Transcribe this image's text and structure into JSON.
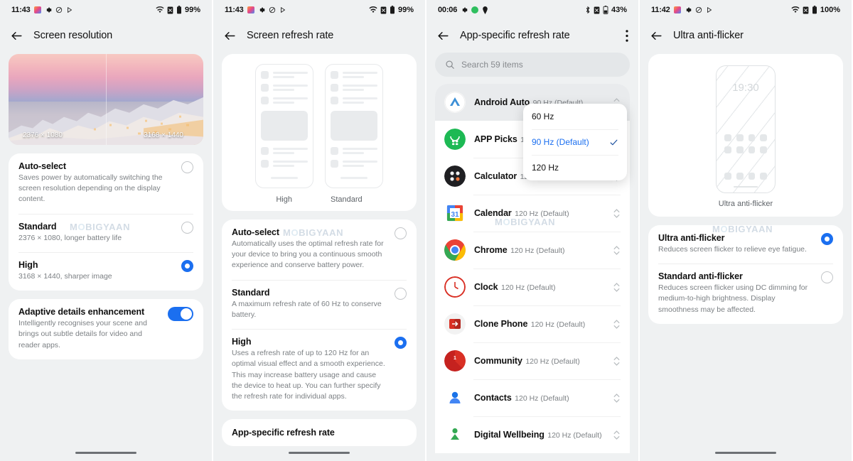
{
  "panels": [
    {
      "status": {
        "time": "11:43",
        "battery": "99%",
        "icons": [
          "photos-icon",
          "gear-icon",
          "dnd-icon",
          "play-icon",
          "wifi-icon",
          "sim-off-icon",
          "battery-icon"
        ]
      },
      "appbar": {
        "title": "Screen resolution",
        "back": "back-arrow-icon"
      },
      "hero": {
        "left_label": "2376 × 1080",
        "right_label": "3168 × 1440"
      },
      "options": [
        {
          "title": "Auto-select",
          "desc": "Saves power by automatically switching the screen resolution depending on the display content.",
          "selected": false
        },
        {
          "title": "Standard",
          "desc": "2376 × 1080, longer battery life",
          "selected": false
        },
        {
          "title": "High",
          "desc": "3168 × 1440, sharper image",
          "selected": true
        }
      ],
      "toggle_item": {
        "title": "Adaptive details enhancement",
        "desc": "Intelligently recognises your scene and brings out subtle details for video and reader apps.",
        "on": true
      },
      "watermark": "MOBIGYAAN"
    },
    {
      "status": {
        "time": "11:43",
        "battery": "99%"
      },
      "appbar": {
        "title": "Screen refresh rate"
      },
      "illustration": {
        "left_caption": "High",
        "right_caption": "Standard"
      },
      "options": [
        {
          "title": "Auto-select",
          "desc": "Automatically uses the optimal refresh rate for your device to bring you a continuous smooth experience and conserve battery power.",
          "selected": false
        },
        {
          "title": "Standard",
          "desc": "A maximum refresh rate of 60 Hz to conserve battery.",
          "selected": false
        },
        {
          "title": "High",
          "desc": "Uses a refresh rate of up to 120 Hz for an optimal visual effect and a smooth experience. This may increase battery usage and cause the device to heat up. You can further specify the refresh rate for individual apps.",
          "selected": true
        }
      ],
      "partial_item": "App-specific refresh rate",
      "watermark": "MOBIGYAAN"
    },
    {
      "status": {
        "time": "00:06",
        "battery": "43%"
      },
      "appbar": {
        "title": "App-specific refresh rate",
        "menu": "kebab-menu-icon"
      },
      "search": {
        "placeholder": "Search 59 items"
      },
      "apps": [
        {
          "name": "Android Auto",
          "hz": "90 Hz  (Default)",
          "icon": "android-auto-icon",
          "selected": true
        },
        {
          "name": "APP Picks",
          "hz": "120 Hz  (Default)",
          "icon": "app-picks-icon",
          "selected": false
        },
        {
          "name": "Calculator",
          "hz": "120 Hz  (Default)",
          "icon": "calculator-icon",
          "selected": false
        },
        {
          "name": "Calendar",
          "hz": "120 Hz  (Default)",
          "icon": "calendar-icon",
          "selected": false
        },
        {
          "name": "Chrome",
          "hz": "120 Hz  (Default)",
          "icon": "chrome-icon",
          "selected": false
        },
        {
          "name": "Clock",
          "hz": "120 Hz  (Default)",
          "icon": "clock-icon",
          "selected": false
        },
        {
          "name": "Clone Phone",
          "hz": "120 Hz  (Default)",
          "icon": "clone-phone-icon",
          "selected": false
        },
        {
          "name": "Community",
          "hz": "120 Hz  (Default)",
          "icon": "community-icon",
          "selected": false
        },
        {
          "name": "Contacts",
          "hz": "120 Hz  (Default)",
          "icon": "contacts-icon",
          "selected": false
        },
        {
          "name": "Digital Wellbeing",
          "hz": "120 Hz  (Default)",
          "icon": "digital-wellbeing-icon",
          "selected": false
        }
      ],
      "dropdown": {
        "items": [
          {
            "label": "60 Hz",
            "active": false
          },
          {
            "label": "90 Hz  (Default)",
            "active": true
          },
          {
            "label": "120 Hz",
            "active": false
          }
        ]
      },
      "watermark": "MOBIGYAAN"
    },
    {
      "status": {
        "time": "11:42",
        "battery": "100%"
      },
      "appbar": {
        "title": "Ultra anti-flicker"
      },
      "illustration": {
        "clock": "19:30",
        "caption": "Ultra anti-flicker"
      },
      "options": [
        {
          "title": "Ultra anti-flicker",
          "desc": "Reduces screen flicker to relieve eye fatigue.",
          "selected": true
        },
        {
          "title": "Standard anti-flicker",
          "desc": "Reduces screen flicker using DC dimming for medium-to-high brightness. Display smoothness may be affected.",
          "selected": false
        }
      ],
      "watermark": "MOBIGYAAN"
    }
  ],
  "colors": {
    "accent": "#1b6ff0",
    "bg": "#eff1f2",
    "card": "#ffffff",
    "text": "#101010",
    "muted": "#7c8084"
  }
}
